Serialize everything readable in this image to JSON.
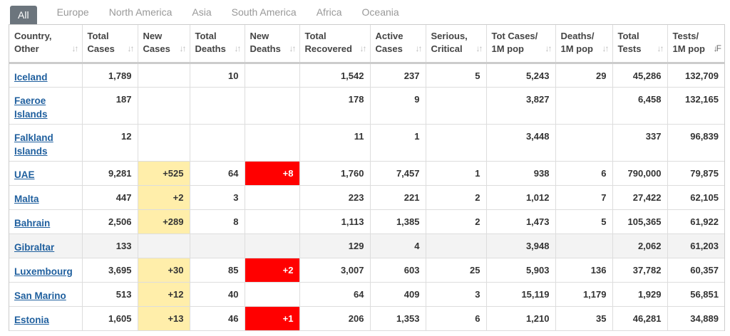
{
  "tabs": [
    "All",
    "Europe",
    "North America",
    "Asia",
    "South America",
    "Africa",
    "Oceania"
  ],
  "active_tab": "All",
  "columns": [
    [
      "Country,",
      "Other"
    ],
    [
      "Total",
      "Cases"
    ],
    [
      "New",
      "Cases"
    ],
    [
      "Total",
      "Deaths"
    ],
    [
      "New",
      "Deaths"
    ],
    [
      "Total",
      "Recovered"
    ],
    [
      "Active",
      "Cases"
    ],
    [
      "Serious,",
      "Critical"
    ],
    [
      "Tot Cases/",
      "1M pop"
    ],
    [
      "Deaths/",
      "1M pop"
    ],
    [
      "Total",
      "Tests"
    ],
    [
      "Tests/",
      "1M pop"
    ]
  ],
  "rows": [
    {
      "country": "Iceland",
      "total_cases": "1,789",
      "new_cases": "",
      "total_deaths": "10",
      "new_deaths": "",
      "recovered": "1,542",
      "active": "237",
      "critical": "5",
      "cases_per_m": "5,243",
      "deaths_per_m": "29",
      "tests": "45,286",
      "tests_per_m": "132,709"
    },
    {
      "country": "Faeroe Islands",
      "total_cases": "187",
      "new_cases": "",
      "total_deaths": "",
      "new_deaths": "",
      "recovered": "178",
      "active": "9",
      "critical": "",
      "cases_per_m": "3,827",
      "deaths_per_m": "",
      "tests": "6,458",
      "tests_per_m": "132,165"
    },
    {
      "country": "Falkland Islands",
      "total_cases": "12",
      "new_cases": "",
      "total_deaths": "",
      "new_deaths": "",
      "recovered": "11",
      "active": "1",
      "critical": "",
      "cases_per_m": "3,448",
      "deaths_per_m": "",
      "tests": "337",
      "tests_per_m": "96,839"
    },
    {
      "country": "UAE",
      "total_cases": "9,281",
      "new_cases": "+525",
      "total_deaths": "64",
      "new_deaths": "+8",
      "recovered": "1,760",
      "active": "7,457",
      "critical": "1",
      "cases_per_m": "938",
      "deaths_per_m": "6",
      "tests": "790,000",
      "tests_per_m": "79,875"
    },
    {
      "country": "Malta",
      "total_cases": "447",
      "new_cases": "+2",
      "total_deaths": "3",
      "new_deaths": "",
      "recovered": "223",
      "active": "221",
      "critical": "2",
      "cases_per_m": "1,012",
      "deaths_per_m": "7",
      "tests": "27,422",
      "tests_per_m": "62,105"
    },
    {
      "country": "Bahrain",
      "total_cases": "2,506",
      "new_cases": "+289",
      "total_deaths": "8",
      "new_deaths": "",
      "recovered": "1,113",
      "active": "1,385",
      "critical": "2",
      "cases_per_m": "1,473",
      "deaths_per_m": "5",
      "tests": "105,365",
      "tests_per_m": "61,922"
    },
    {
      "country": "Gibraltar",
      "total_cases": "133",
      "new_cases": "",
      "total_deaths": "",
      "new_deaths": "",
      "recovered": "129",
      "active": "4",
      "critical": "",
      "cases_per_m": "3,948",
      "deaths_per_m": "",
      "tests": "2,062",
      "tests_per_m": "61,203",
      "gray": true
    },
    {
      "country": "Luxembourg",
      "total_cases": "3,695",
      "new_cases": "+30",
      "total_deaths": "85",
      "new_deaths": "+2",
      "recovered": "3,007",
      "active": "603",
      "critical": "25",
      "cases_per_m": "5,903",
      "deaths_per_m": "136",
      "tests": "37,782",
      "tests_per_m": "60,357"
    },
    {
      "country": "San Marino",
      "total_cases": "513",
      "new_cases": "+12",
      "total_deaths": "40",
      "new_deaths": "",
      "recovered": "64",
      "active": "409",
      "critical": "3",
      "cases_per_m": "15,119",
      "deaths_per_m": "1,179",
      "tests": "1,929",
      "tests_per_m": "56,851"
    },
    {
      "country": "Estonia",
      "total_cases": "1,605",
      "new_cases": "+13",
      "total_deaths": "46",
      "new_deaths": "+1",
      "recovered": "206",
      "active": "1,353",
      "critical": "6",
      "cases_per_m": "1,210",
      "deaths_per_m": "35",
      "tests": "46,281",
      "tests_per_m": "34,889"
    }
  ],
  "colors": {
    "new_cases_highlight": "#ffeeaa",
    "new_deaths_highlight": "#ff0000",
    "link": "#1f5f9e",
    "active_tab": "#6c757d"
  },
  "icons": {
    "sort": "sort-arrows-icon",
    "sort_active": "sort-desc-icon"
  }
}
